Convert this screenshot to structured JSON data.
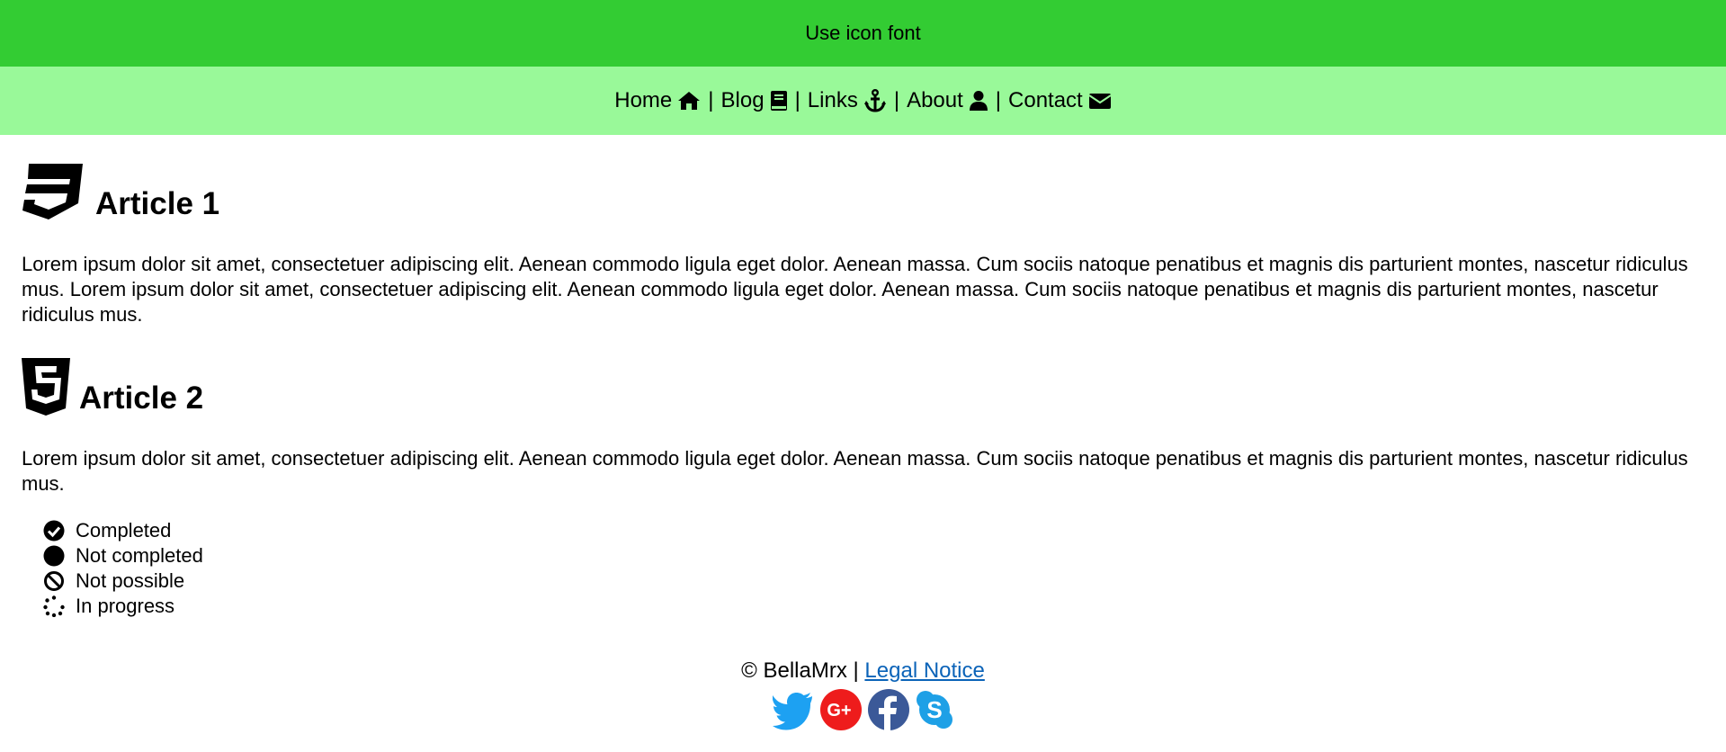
{
  "header": {
    "title": "Use icon font"
  },
  "nav": {
    "items": [
      {
        "label": "Home",
        "icon": "home-icon"
      },
      {
        "label": "Blog",
        "icon": "book-icon"
      },
      {
        "label": "Links",
        "icon": "anchor-icon"
      },
      {
        "label": "About",
        "icon": "user-icon"
      },
      {
        "label": "Contact",
        "icon": "envelope-icon"
      }
    ],
    "separator": "|"
  },
  "articles": [
    {
      "title": "Article 1",
      "icon": "css3-icon",
      "text": "Lorem ipsum dolor sit amet, consectetuer adipiscing elit. Aenean commodo ligula eget dolor. Aenean massa. Cum sociis natoque penatibus et magnis dis parturient montes, nascetur ridiculus mus. Lorem ipsum dolor sit amet, consectetuer adipiscing elit. Aenean commodo ligula eget dolor. Aenean massa. Cum sociis natoque penatibus et magnis dis parturient montes, nascetur ridiculus mus."
    },
    {
      "title": "Article 2",
      "icon": "html5-icon",
      "text": "Lorem ipsum dolor sit amet, consectetuer adipiscing elit. Aenean commodo ligula eget dolor. Aenean massa. Cum sociis natoque penatibus et magnis dis parturient montes, nascetur ridiculus mus."
    }
  ],
  "status_list": [
    {
      "label": "Completed",
      "icon": "check-circle-icon"
    },
    {
      "label": "Not completed",
      "icon": "circle-icon"
    },
    {
      "label": "Not possible",
      "icon": "ban-icon"
    },
    {
      "label": "In progress",
      "icon": "spinner-icon"
    }
  ],
  "footer": {
    "copyright": "© BellaMrx",
    "separator": "|",
    "legal_link": "Legal Notice",
    "social": [
      "twitter-icon",
      "google-plus-icon",
      "facebook-icon",
      "skype-icon"
    ]
  },
  "colors": {
    "header_bg": "#33cc33",
    "nav_bg": "#99f999",
    "link": "#0b63b8",
    "twitter": "#1da1f2",
    "google_plus": "#ee1c1c",
    "facebook": "#3b5998",
    "skype": "#1ea0e6"
  }
}
